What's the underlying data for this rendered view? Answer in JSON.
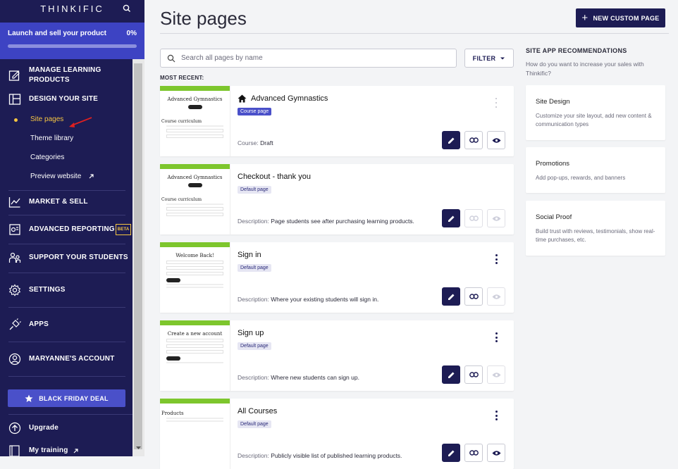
{
  "sidebar": {
    "logo": "THINKIFIC",
    "launch": {
      "label": "Launch and sell your product",
      "percent": "0%",
      "progress": 0
    },
    "nav": {
      "manage": "MANAGE LEARNING PRODUCTS",
      "design": "DESIGN YOUR SITE",
      "sub_items": [
        "Site pages",
        "Theme library",
        "Categories",
        "Preview website"
      ],
      "market": "MARKET & SELL",
      "reporting": "ADVANCED REPORTING",
      "reporting_badge": "BETA",
      "support": "SUPPORT YOUR STUDENTS",
      "settings": "SETTINGS",
      "apps": "APPS",
      "account": "MARYANNE'S ACCOUNT"
    },
    "black_friday": "BLACK FRIDAY DEAL",
    "upgrade": "Upgrade",
    "training": "My training"
  },
  "header": {
    "title": "Site pages",
    "new_button": "NEW CUSTOM PAGE"
  },
  "search": {
    "placeholder": "Search all pages by name"
  },
  "filter": "FILTER",
  "recent_label": "MOST RECENT:",
  "pages": [
    {
      "name": "Advanced Gymnastics",
      "badge": "Course page",
      "desc_label": "Course:",
      "desc": "Draft",
      "thumb_title": "Advanced Gymnastics",
      "thumb_sub": "Course curriculum"
    },
    {
      "name": "Checkout - thank you",
      "badge": "Default page",
      "desc_label": "Description:",
      "desc": "Page students see after purchasing learning products.",
      "thumb_title": "Advanced Gymnastics",
      "thumb_sub": "Course curriculum"
    },
    {
      "name": "Sign in",
      "badge": "Default page",
      "desc_label": "Description:",
      "desc": "Where your existing students will sign in.",
      "thumb_title": "Welcome Back!",
      "thumb_sub": ""
    },
    {
      "name": "Sign up",
      "badge": "Default page",
      "desc_label": "Description:",
      "desc": "Where new students can sign up.",
      "thumb_title": "Create a new account",
      "thumb_sub": ""
    },
    {
      "name": "All Courses",
      "badge": "Default page",
      "desc_label": "Description:",
      "desc": "Publicly visible list of published learning products.",
      "thumb_title": "Products",
      "thumb_sub": ""
    }
  ],
  "recommendations": {
    "heading": "SITE APP RECOMMENDATIONS",
    "sub": "How do you want to increase your sales with Thinkific?",
    "cards": [
      {
        "title": "Site Design",
        "desc": "Customize your site layout, add new content & communication types"
      },
      {
        "title": "Promotions",
        "desc": "Add pop-ups, rewards, and banners"
      },
      {
        "title": "Social Proof",
        "desc": "Build trust with reviews, testimonials, show real-time purchases, etc."
      }
    ]
  },
  "colors": {
    "sidebar": "#1d1c54",
    "accent": "#4a50c9",
    "highlight": "#f5c542",
    "thumb_bar": "#7dc62d"
  }
}
